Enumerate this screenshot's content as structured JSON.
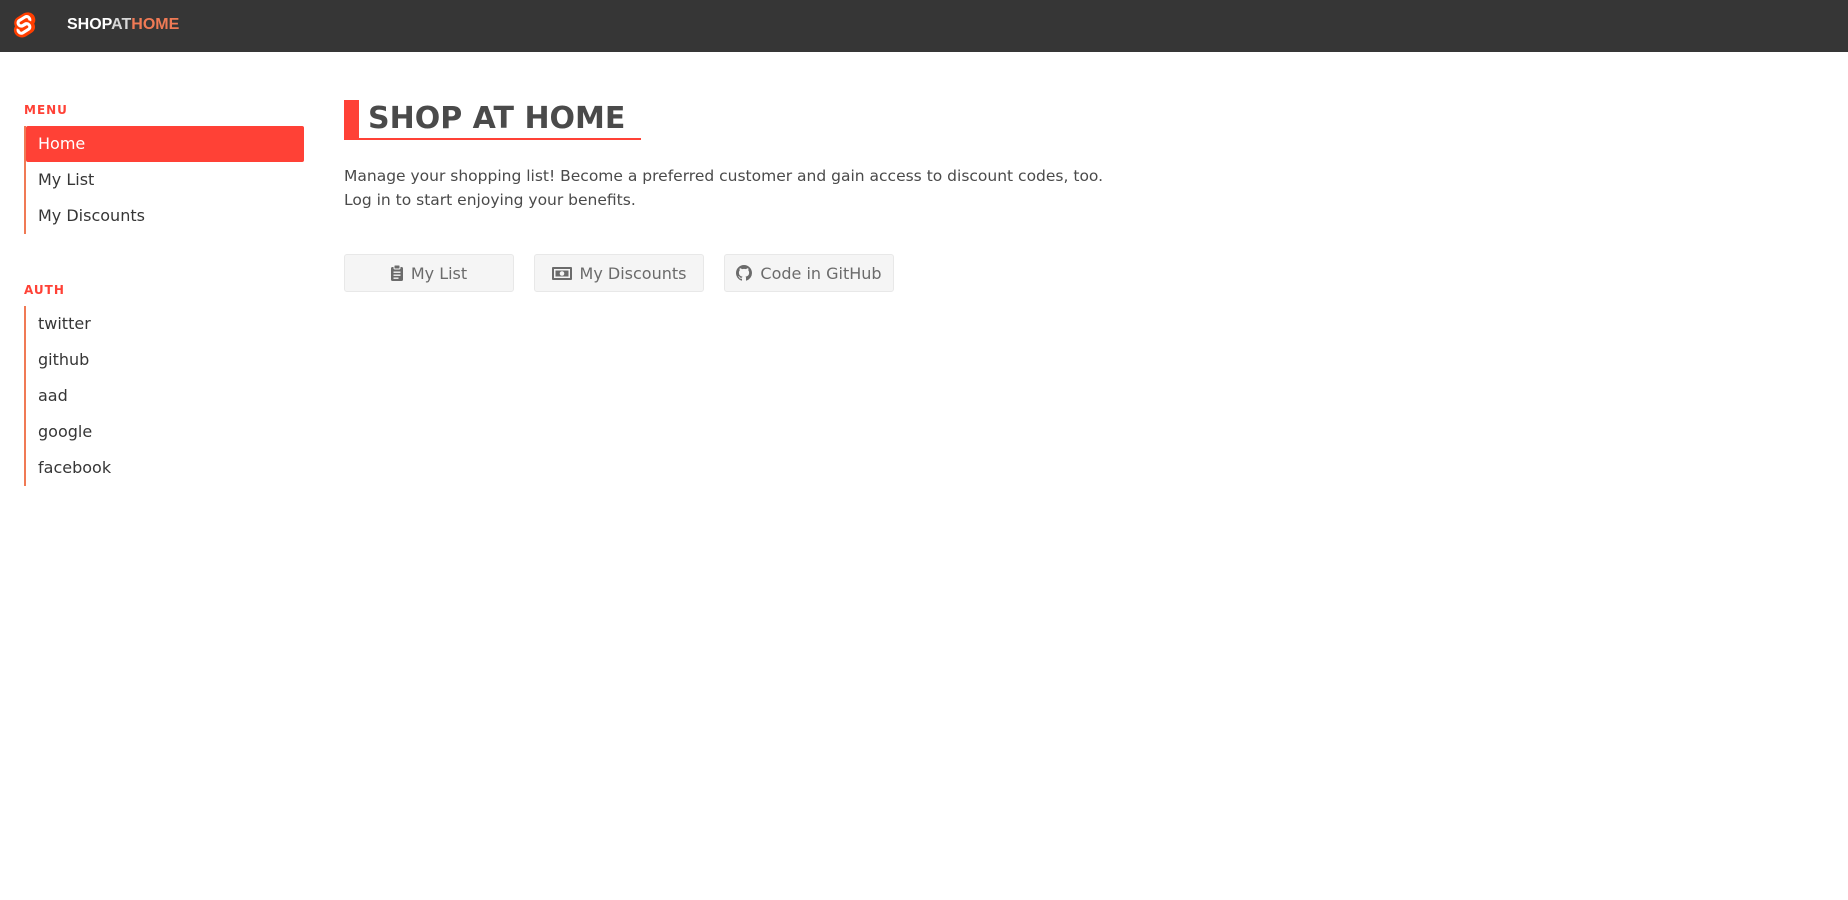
{
  "brand": {
    "part1": "SHOP",
    "part2": "AT",
    "part3": "HOME"
  },
  "sidebar": {
    "menu_label": "MENU",
    "menu_items": [
      {
        "label": "Home",
        "active": true
      },
      {
        "label": "My List",
        "active": false
      },
      {
        "label": "My Discounts",
        "active": false
      }
    ],
    "auth_label": "AUTH",
    "auth_items": [
      {
        "label": "twitter"
      },
      {
        "label": "github"
      },
      {
        "label": "aad"
      },
      {
        "label": "google"
      },
      {
        "label": "facebook"
      }
    ]
  },
  "main": {
    "title": "SHOP AT HOME",
    "description_line1": "Manage your shopping list! Become a preferred customer and gain access to discount codes, too.",
    "description_line2": "Log in to start enjoying your benefits.",
    "buttons": [
      {
        "label": "My List",
        "icon": "clipboard-icon"
      },
      {
        "label": "My Discounts",
        "icon": "money-bill-icon"
      },
      {
        "label": "Code in GitHub",
        "icon": "github-icon"
      }
    ]
  },
  "colors": {
    "accent": "#ff4136",
    "topbar": "#363636",
    "brand_highlight": "#f07a55"
  }
}
